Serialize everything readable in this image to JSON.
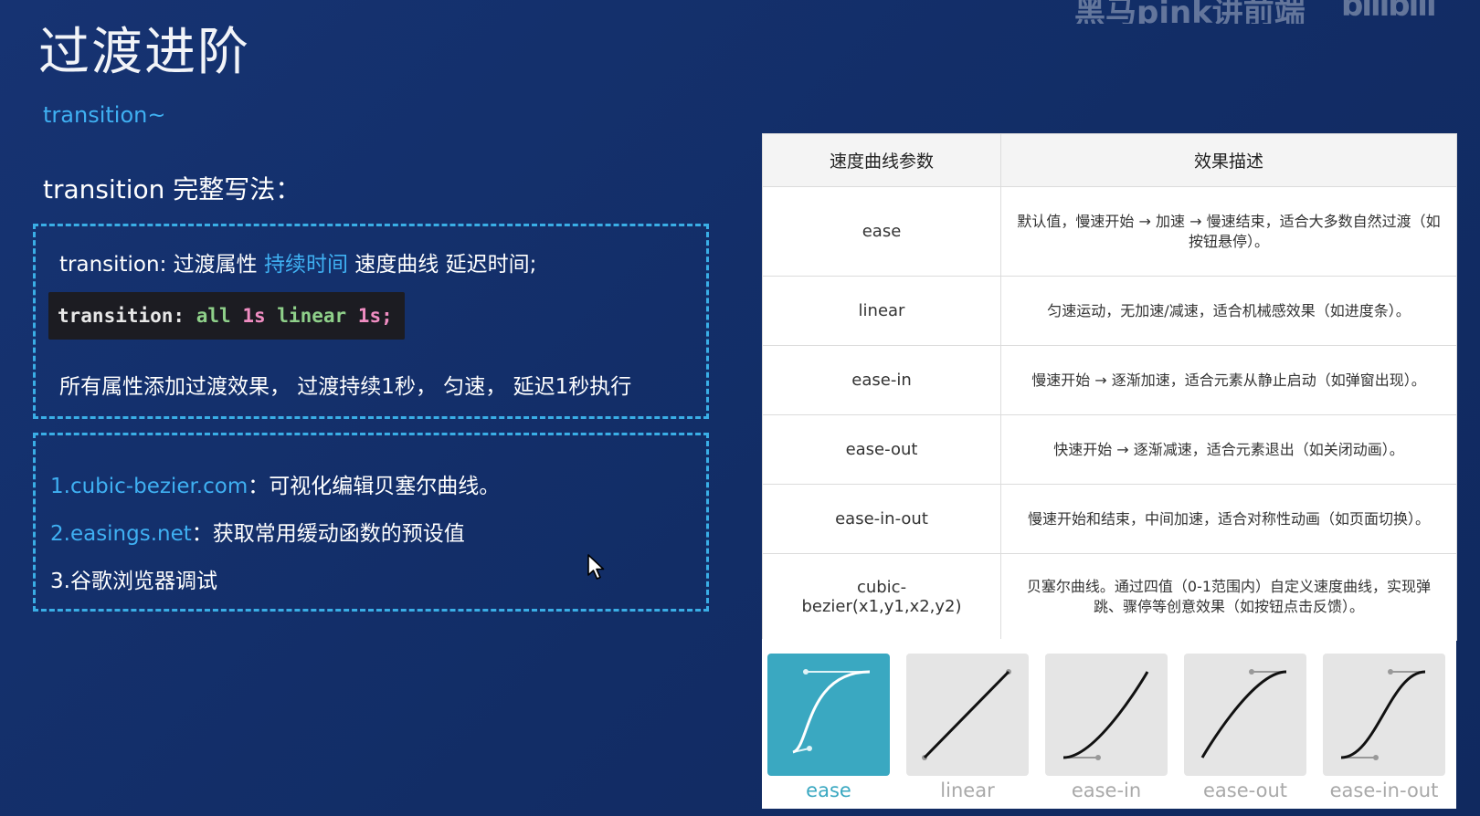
{
  "watermark": {
    "text": "黑马pink讲前端",
    "logo": "bilibili"
  },
  "page": {
    "title": "过渡进阶",
    "subtitle": "transition~",
    "heading": "transition 完整写法："
  },
  "syntax": {
    "prefix": "transition: 过渡属性 ",
    "duration": "持续时间",
    "suffix": " 速度曲线 延迟时间;"
  },
  "code": {
    "property": "transition:",
    "value_all": "all",
    "value_duration": "1s",
    "value_timing": "linear",
    "value_delay": "1s;"
  },
  "explanation": "所有属性添加过渡效果， 过渡持续1秒， 匀速， 延迟1秒执行",
  "tools": [
    {
      "link": "1.cubic-bezier.com",
      "text": "：可视化编辑贝塞尔曲线。"
    },
    {
      "link": "2.easings.net",
      "text": "：获取常用缓动函数的预设值"
    },
    {
      "link": "",
      "text": "3.谷歌浏览器调试"
    }
  ],
  "table": {
    "headers": [
      "速度曲线参数",
      "效果描述"
    ],
    "rows": [
      {
        "param": "ease",
        "desc": "默认值，慢速开始 → 加速 → 慢速结束，适合大多数自然过渡（如按钮悬停）。"
      },
      {
        "param": "linear",
        "desc": "匀速运动，无加速/减速，适合机械感效果（如进度条）。"
      },
      {
        "param": "ease-in",
        "desc": "慢速开始 → 逐渐加速，适合元素从静止启动（如弹窗出现）。"
      },
      {
        "param": "ease-out",
        "desc": "快速开始 → 逐渐减速，适合元素退出（如关闭动画）。"
      },
      {
        "param": "ease-in-out",
        "desc": "慢速开始和结束，中间加速，适合对称性动画（如页面切换）。"
      },
      {
        "param": "cubic-bezier(x1,y1,x2,y2)",
        "desc": "贝塞尔曲线。通过四值（0-1范围内）自定义速度曲线，实现弹跳、骤停等创意效果（如按钮点击反馈）。"
      }
    ]
  },
  "curves": {
    "labels": [
      "ease",
      "linear",
      "ease-in",
      "ease-out",
      "ease-in-out"
    ],
    "selected": "ease"
  },
  "colors": {
    "background": "#14306a",
    "accent_blue": "#3fb0f2",
    "dashed_border": "#3aaee6",
    "active_card": "#3aa8c1"
  }
}
